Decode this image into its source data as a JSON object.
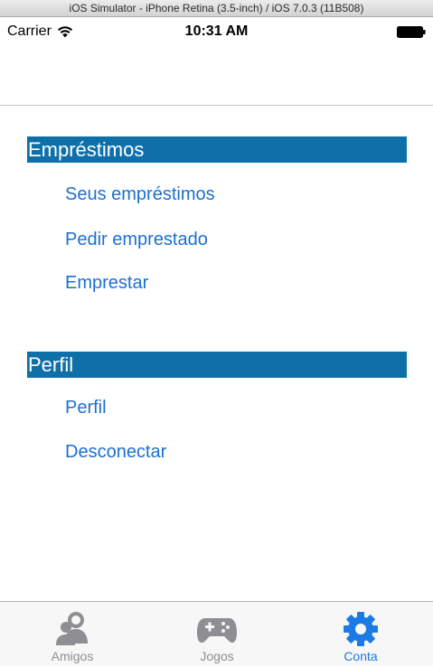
{
  "window": {
    "title": "iOS Simulator - iPhone Retina (3.5-inch) / iOS 7.0.3 (11B508)"
  },
  "status_bar": {
    "carrier": "Carrier",
    "time": "10:31 AM"
  },
  "sections": [
    {
      "header": "Empréstimos",
      "items": [
        "Seus empréstimos",
        "Pedir emprestado",
        "Emprestar"
      ]
    },
    {
      "header": "Perfil",
      "items": [
        "Perfil",
        "Desconectar"
      ]
    }
  ],
  "tab_bar": {
    "tabs": [
      {
        "label": "Amigos",
        "icon": "friends-icon",
        "active": false
      },
      {
        "label": "Jogos",
        "icon": "gamepad-icon",
        "active": false
      },
      {
        "label": "Conta",
        "icon": "gear-icon",
        "active": true
      }
    ]
  },
  "colors": {
    "section_header_bg": "#0f70a9",
    "link": "#1b6fd2",
    "tab_active": "#1a7be6",
    "tab_inactive": "#8e8e93"
  }
}
